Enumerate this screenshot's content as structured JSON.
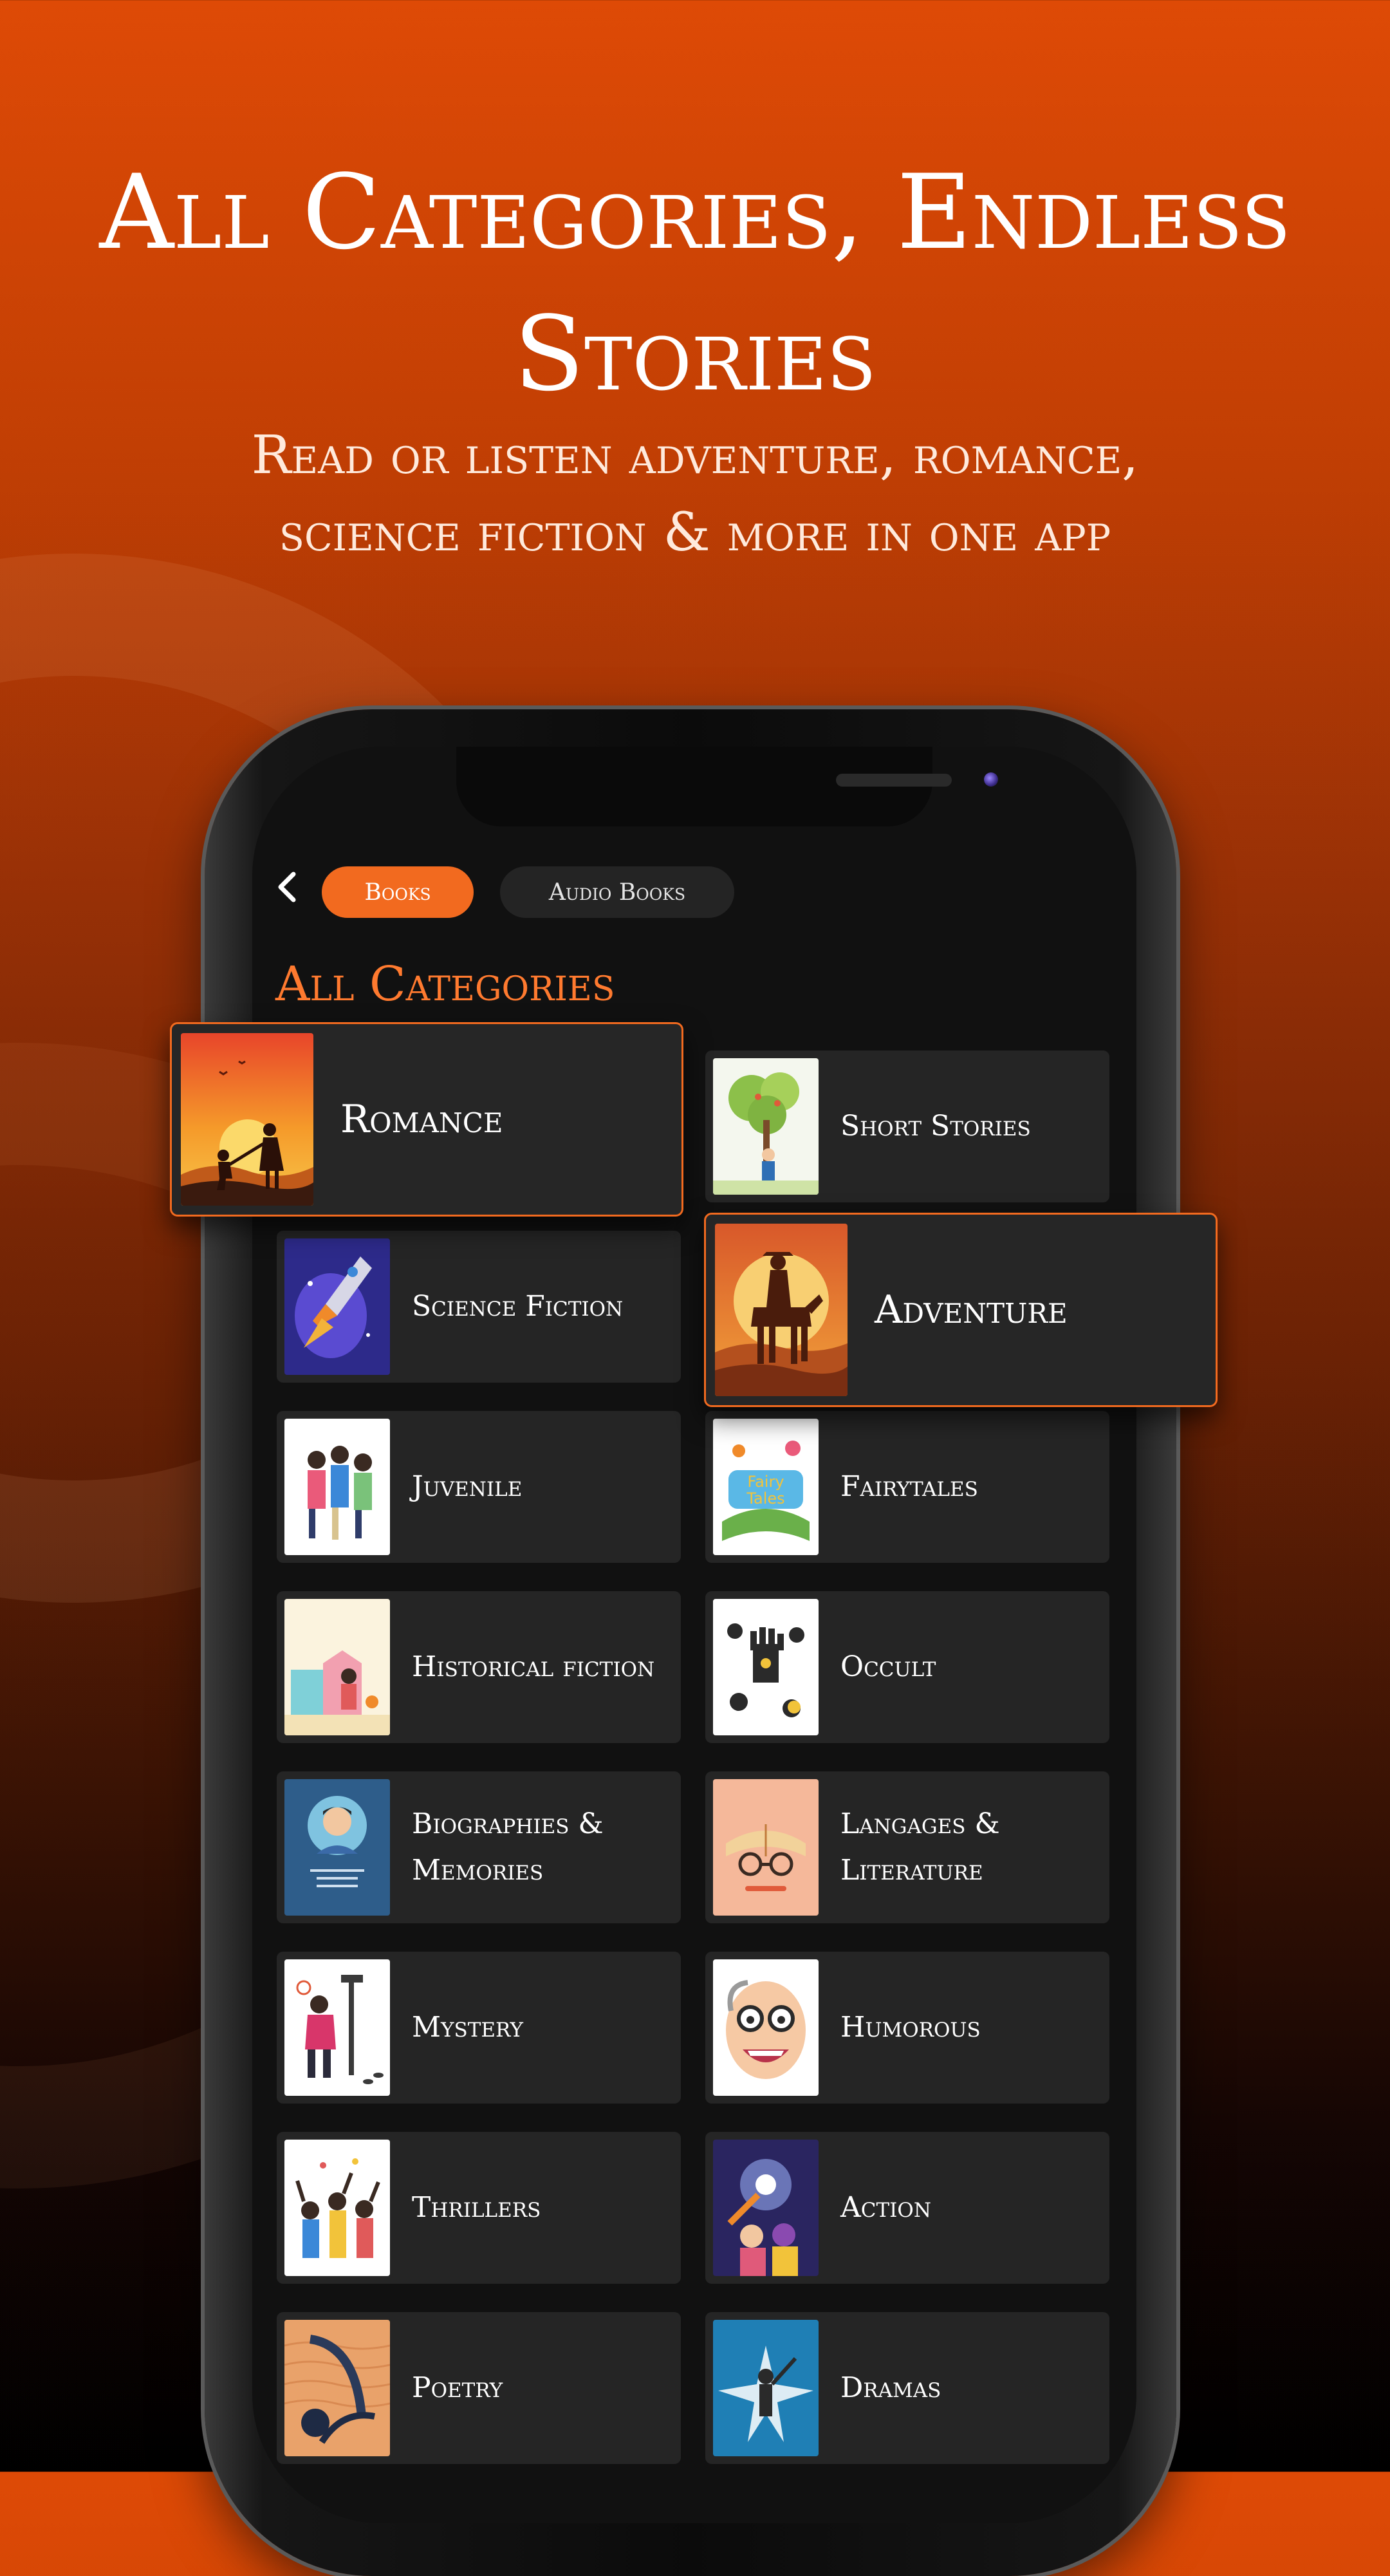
{
  "hero": {
    "title": "All Categories, Endless\nStories",
    "subtitle": "Read or listen adventure, romance, science fiction & more in one app"
  },
  "app": {
    "tabs": [
      {
        "label": "Books",
        "active": true
      },
      {
        "label": "Audio Books",
        "active": false
      }
    ],
    "section_title": "All Categories",
    "featured": [
      {
        "label": "Romance",
        "icon": "romance-cover"
      },
      {
        "label": "Adventure",
        "icon": "adventure-cover"
      }
    ],
    "categories": [
      {
        "label": "Short Stories",
        "icon": "short-stories-cover"
      },
      {
        "label": "Science Fiction",
        "icon": "science-fiction-cover"
      },
      {
        "label": "Juvenile",
        "icon": "juvenile-cover"
      },
      {
        "label": "Fairytales",
        "icon": "fairytales-cover"
      },
      {
        "label": "Historical fiction",
        "icon": "historical-fiction-cover"
      },
      {
        "label": "Occult",
        "icon": "occult-cover"
      },
      {
        "label": "Biographies & Memories",
        "icon": "biographies-cover"
      },
      {
        "label": "Langages & Literature",
        "icon": "literature-cover"
      },
      {
        "label": "Mystery",
        "icon": "mystery-cover"
      },
      {
        "label": "Humorous",
        "icon": "humorous-cover"
      },
      {
        "label": "Thrillers",
        "icon": "thrillers-cover"
      },
      {
        "label": "Action",
        "icon": "action-cover"
      },
      {
        "label": "Poetry",
        "icon": "poetry-cover"
      },
      {
        "label": "Dramas",
        "icon": "dramas-cover"
      }
    ]
  },
  "colors": {
    "accent": "#f26a1f",
    "card_bg": "#252525",
    "screen_bg": "#111111"
  }
}
